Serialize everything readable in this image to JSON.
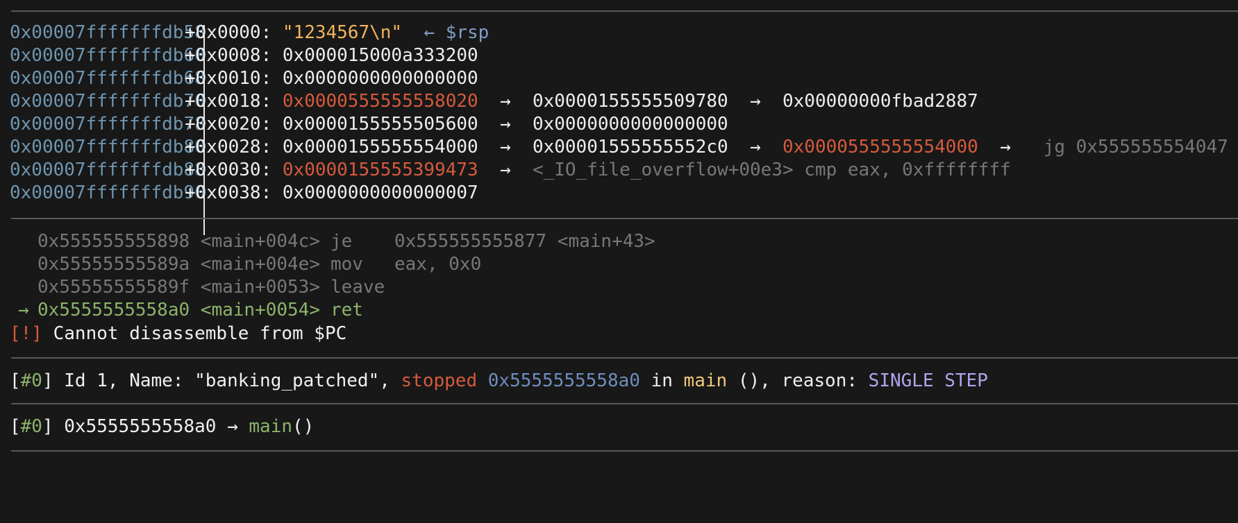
{
  "stack": {
    "rows": [
      {
        "address": "0x00007fffffffdb58",
        "offset": "+0x0000:",
        "value": "\"1234567\\n\"",
        "tail_arrow": "←",
        "tail": "$rsp"
      },
      {
        "address": "0x00007fffffffdb60",
        "offset": "+0x0008:",
        "value": "0x000015000a333200"
      },
      {
        "address": "0x00007fffffffdb68",
        "offset": "+0x0010:",
        "value": "0x0000000000000000"
      },
      {
        "address": "0x00007fffffffdb70",
        "offset": "+0x0018:",
        "value": "0x0000555555558020",
        "arrow1": "→",
        "v2": "0x0000155555509780",
        "arrow2": "→",
        "v3": "0x00000000fbad2887"
      },
      {
        "address": "0x00007fffffffdb78",
        "offset": "+0x0020:",
        "value": "0x0000155555505600",
        "arrow1": "→",
        "v2": "0x0000000000000000"
      },
      {
        "address": "0x00007fffffffdb80",
        "offset": "+0x0028:",
        "value": "0x0000155555554000",
        "arrow1": "→",
        "v2": "0x00001555555552c0",
        "arrow2": "→",
        "v3": "0x0000555555554000",
        "arrow3": "→",
        "v4": "jg 0x555555554047"
      },
      {
        "address": "0x00007fffffffdb88",
        "offset": "+0x0030:",
        "value": "0x0000155555399473",
        "arrow1": "→",
        "v2": "<_IO_file_overflow+00e3> cmp eax, 0xffffffff"
      },
      {
        "address": "0x00007fffffffdb90",
        "offset": "+0x0038:",
        "value": "0x0000000000000007"
      }
    ]
  },
  "code": {
    "rows": [
      {
        "marker": "",
        "address": "0x555555555898 <main+004c>",
        "mnemonic": "je",
        "operands": "0x555555555877 <main+43>"
      },
      {
        "marker": "",
        "address": "0x55555555589a <main+004e>",
        "mnemonic": "mov",
        "operands": "eax, 0x0"
      },
      {
        "marker": "",
        "address": "0x55555555589f <main+0053>",
        "mnemonic": "leave",
        "operands": ""
      },
      {
        "marker": "→",
        "address": "0x5555555558a0 <main+0054>",
        "mnemonic": "ret",
        "operands": ""
      }
    ],
    "warning_tag": "[!]",
    "warning_text": "Cannot disassemble from $PC"
  },
  "threads": {
    "open": "[",
    "num": "#0",
    "close": "]",
    "text1": " Id 1, Name: \"banking_patched\", ",
    "state": "stopped",
    "addr": "0x5555555558a0",
    "in": " in ",
    "func": "main",
    "text2": " (), reason: ",
    "reason": "SINGLE STEP"
  },
  "trace": {
    "open": "[",
    "num": "#0",
    "close": "]",
    "addr": " 0x5555555558a0 → ",
    "func": "main",
    "parens": "()"
  }
}
